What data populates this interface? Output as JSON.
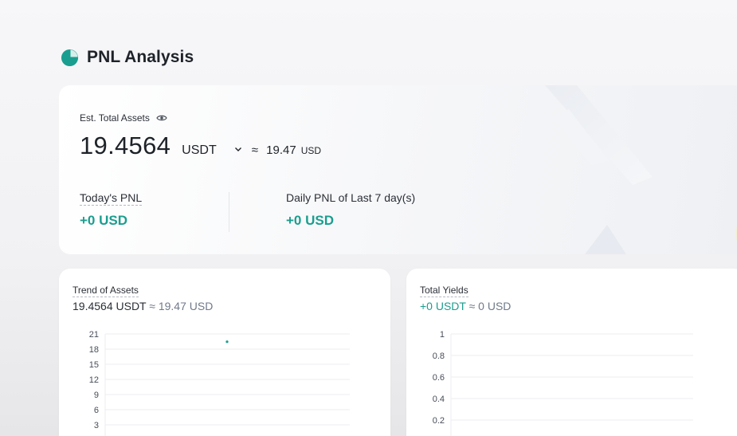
{
  "header": {
    "title": "PNL Analysis",
    "icon": "pie-chart-icon",
    "accent": "#1a9e8f"
  },
  "summary": {
    "est_label": "Est. Total Assets",
    "assets_value": "19.4564",
    "assets_unit": "USDT",
    "approx_symbol": "≈",
    "approx_value": "19.47",
    "approx_unit": "USD",
    "todays_pnl_label": "Today's PNL",
    "todays_pnl_value": "+0 USD",
    "daily_pnl_label": "Daily PNL of Last 7 day(s)",
    "daily_pnl_value": "+0 USD"
  },
  "trend_card": {
    "title": "Trend of Assets",
    "value": "19.4564 USDT",
    "approx": "≈ 19.47 USD"
  },
  "yields_card": {
    "title": "Total Yields",
    "value": "+0 USDT",
    "approx": "≈ 0 USD"
  },
  "chart_data": [
    {
      "type": "scatter",
      "title": "Trend of Assets",
      "y_ticks": [
        "21",
        "18",
        "15",
        "12",
        "9",
        "6",
        "3"
      ],
      "ylim": [
        0,
        21
      ],
      "points": [
        {
          "y": 19.4564
        }
      ],
      "grid": true,
      "color": "#1a9e8f"
    },
    {
      "type": "line",
      "title": "Total Yields",
      "y_ticks": [
        "1",
        "0.8",
        "0.6",
        "0.4",
        "0.2"
      ],
      "ylim": [
        0,
        1
      ],
      "grid": true,
      "color": "#1a9e8f"
    }
  ]
}
